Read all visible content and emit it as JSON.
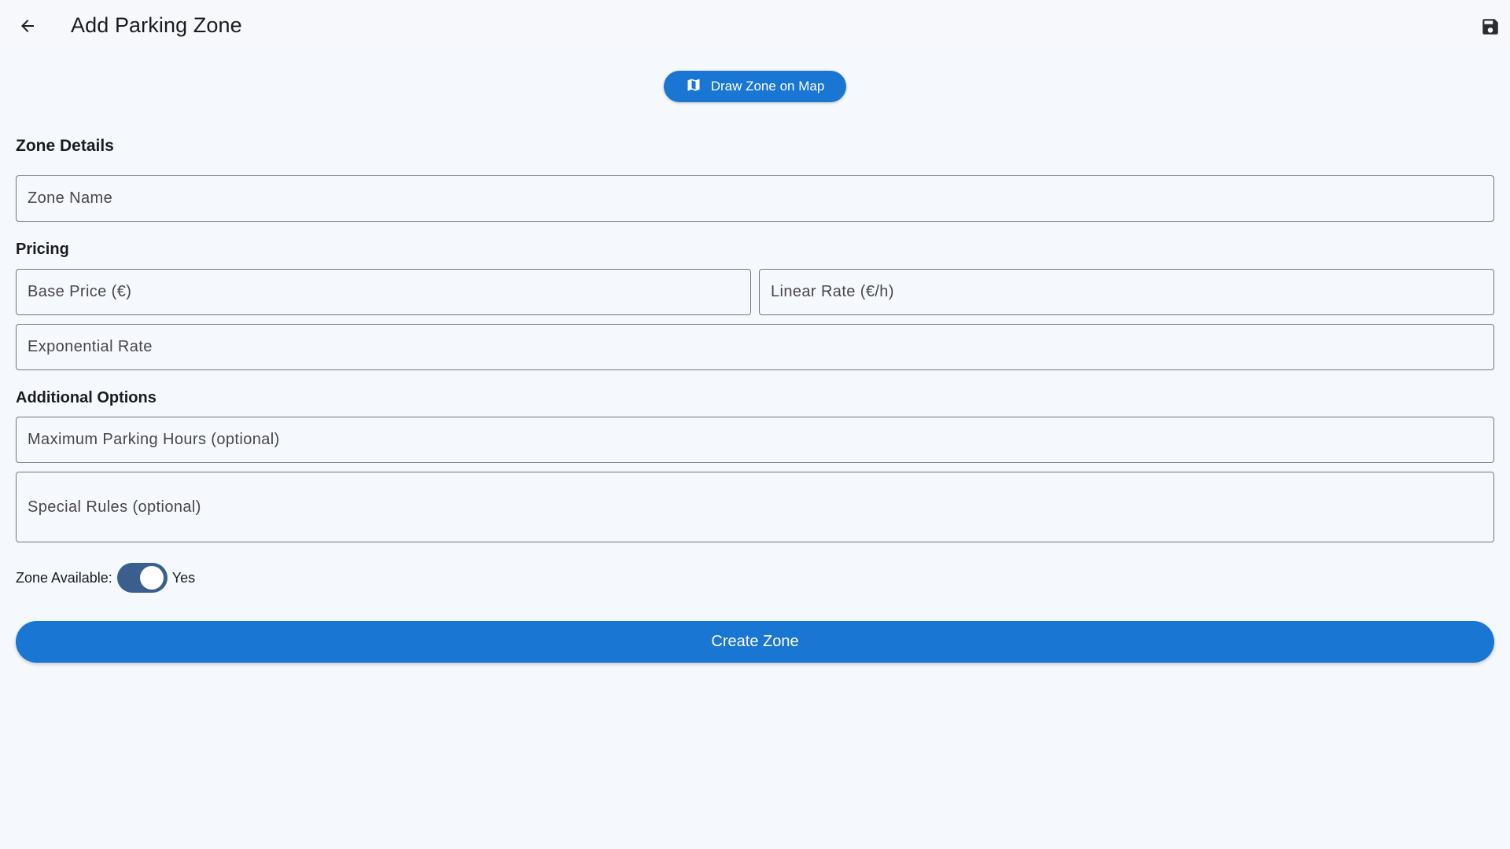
{
  "appbar": {
    "title": "Add Parking Zone",
    "back_icon": "arrow-left-icon",
    "save_icon": "floppy-disk-icon"
  },
  "draw_button": {
    "label": "Draw Zone on Map",
    "icon": "map-icon"
  },
  "sections": {
    "zone_details": "Zone Details",
    "pricing": "Pricing",
    "additional_options": "Additional Options"
  },
  "fields": {
    "zone_name": {
      "label": "Zone Name",
      "value": ""
    },
    "base_price": {
      "label": "Base Price (€)",
      "value": ""
    },
    "linear_rate": {
      "label": "Linear Rate (€/h)",
      "value": ""
    },
    "exponential_rate": {
      "label": "Exponential Rate",
      "value": ""
    },
    "max_hours": {
      "label": "Maximum Parking Hours (optional)",
      "value": ""
    },
    "special_rules": {
      "label": "Special Rules (optional)",
      "value": ""
    }
  },
  "availability": {
    "label": "Zone Available:",
    "state_label": "Yes",
    "enabled": true
  },
  "create_button": {
    "label": "Create Zone"
  },
  "colors": {
    "primary": "#1976d2",
    "switch_track": "#3a5f8f",
    "background": "#f5f8fd",
    "outline": "#79747e"
  }
}
